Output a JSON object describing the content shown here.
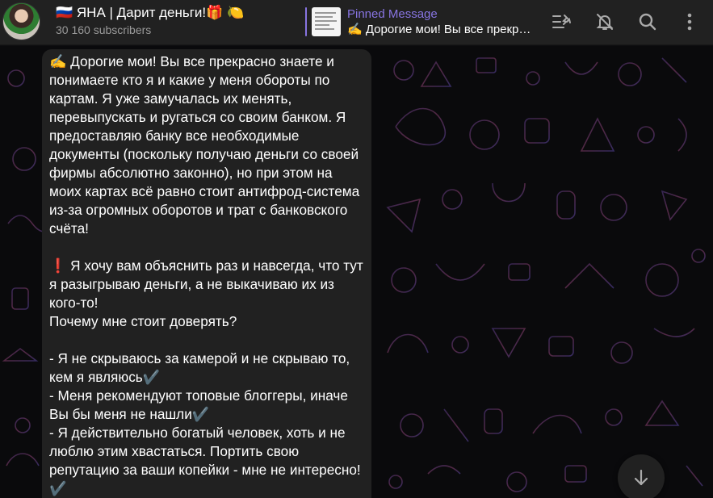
{
  "header": {
    "title": "🇷🇺 ЯНА | Дарит деньги!🎁 🍋",
    "subscribers": "30 160 subscribers",
    "icons": [
      "avatar",
      "pinned-list-icon",
      "mute-bell-icon",
      "search-icon",
      "more-vertical-icon"
    ]
  },
  "pinned": {
    "label": "Pinned Message",
    "text": "✍️ Дорогие мои! Вы все прекрасно знаете..."
  },
  "message": {
    "text": "✍️ Дорогие мои! Вы все прекрасно знаете и понимаете кто я и какие у меня обороты по картам. Я уже замучалась их менять, перевыпускать и ругаться со своим банком. Я предоставляю банку все необходимые документы (поскольку получаю деньги со своей фирмы абсолютно законно), но при этом на моих картах всё равно стоит антифрод-система из-за огромных оборотов и трат с банковского счёта!\n\n❗️ Я хочу вам объяснить раз и навсегда, что тут я разыгрываю деньги, а не выкачиваю их из кого-то!\nПочему мне стоит доверять?\n\n- Я не скрываюсь за камерой и не скрываю то, кем я являюсь✔️\n- Меня рекомендуют топовые блоггеры, иначе Вы бы меня не нашли✔️\n- Я действительно богатый человек, хоть и не люблю этим хвастаться. Портить свою репутацию за ваши копейки - мне не интересно!✔️"
  },
  "colors": {
    "header_bg": "#212121",
    "accent": "#8774e1",
    "bubble_bg": "#212121",
    "chat_bg": "#0a0a0c",
    "muted_text": "#9a9a9a"
  },
  "scroll_button": {
    "icon": "arrow-down-icon"
  }
}
